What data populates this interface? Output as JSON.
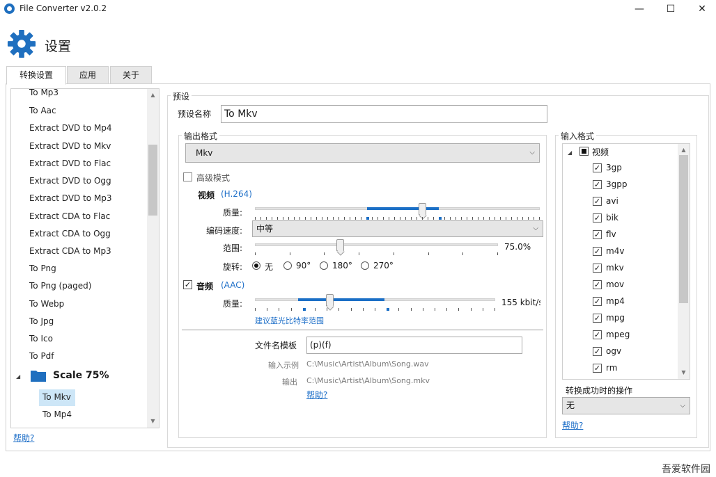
{
  "window": {
    "title": "File Converter v2.0.2",
    "minimize": "—",
    "maximize": "☐",
    "close": "✕"
  },
  "header": {
    "title": "设置",
    "icon": "gear-icon"
  },
  "tabs": [
    {
      "label": "转换设置"
    },
    {
      "label": "应用"
    },
    {
      "label": "关于"
    }
  ],
  "presets": {
    "items": [
      "To Mp3",
      "To Aac",
      "Extract DVD to Mp4",
      "Extract DVD to Mkv",
      "Extract DVD to Flac",
      "Extract DVD to Ogg",
      "Extract DVD to Mp3",
      "Extract CDA to Flac",
      "Extract CDA to Ogg",
      "Extract CDA to Mp3",
      "To Png",
      "To Png (paged)",
      "To Webp",
      "To Jpg",
      "To Ico",
      "To Pdf"
    ],
    "folder": {
      "label": "Scale 75%",
      "icon": "folder-icon"
    },
    "folder_items": [
      "To Mkv",
      "To Mp4"
    ],
    "help": "帮助?"
  },
  "preset": {
    "group_label": "预设",
    "name_label": "预设名称",
    "name_value": "To Mkv"
  },
  "output": {
    "group_label": "输出格式",
    "format": "Mkv",
    "advanced_label": "高级模式",
    "video": {
      "label": "视频",
      "codec": "(H.264)",
      "quality_label": "质量:",
      "quality": 0.6,
      "speed_label": "编码速度:",
      "speed_value": "中等",
      "scale_label": "范围:",
      "scale_value": "75.0%",
      "scale": 0.36,
      "rotate_label": "旋转:",
      "rotations": [
        "无",
        "90°",
        "180°",
        "270°"
      ]
    },
    "audio": {
      "label": "音频",
      "codec": "(AAC)",
      "quality_label": "质量:",
      "quality_value": "155 kbit/s",
      "quality": 0.3,
      "hint": "建议蓝光比特率范围"
    },
    "template_label": "文件名模板",
    "template_value": "(p)(f)",
    "input_example_label": "输入示例",
    "input_example": "C:\\Music\\Artist\\Album\\Song.wav",
    "output_example_label": "输出",
    "output_example": "C:\\Music\\Artist\\Album\\Song.mkv",
    "help": "帮助?"
  },
  "input": {
    "group_label": "输入格式",
    "root_label": "视频",
    "formats": [
      "3gp",
      "3gpp",
      "avi",
      "bik",
      "flv",
      "m4v",
      "mkv",
      "mov",
      "mp4",
      "mpg",
      "mpeg",
      "ogv",
      "rm"
    ],
    "on_success_label": "转换成功时的操作",
    "on_success_value": "无",
    "help": "帮助?"
  },
  "watermark": "吾爱软件园"
}
